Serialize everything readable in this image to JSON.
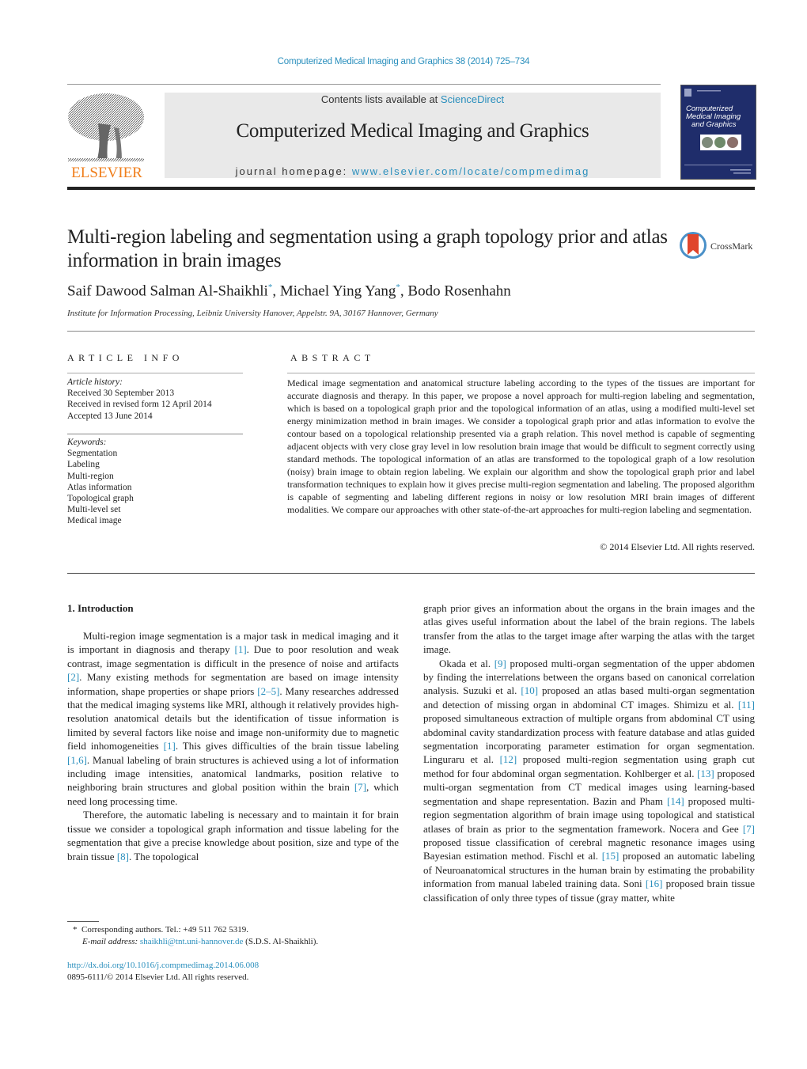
{
  "header": {
    "journal_ref": "Computerized Medical Imaging and Graphics 38 (2014) 725–734",
    "contents_prefix": "Contents lists available at ",
    "contents_link": "ScienceDirect",
    "journal_title": "Computerized Medical Imaging and Graphics",
    "homepage_prefix": "journal homepage: ",
    "homepage_link": "www.elsevier.com/locate/compmedimag",
    "publisher_logo_text": "ELSEVIER",
    "cover_title": "Computerized Medical Imaging and Graphics",
    "colors": {
      "link": "#2a8fbd",
      "elsevier_orange": "#f07e1b",
      "cover_blue": "#1f2d6b"
    }
  },
  "article": {
    "title": "Multi-region labeling and segmentation using a graph topology prior and atlas information in brain images",
    "crossmark_label": "CrossMark",
    "authors": [
      {
        "name": "Saif Dawood Salman Al-Shaikhli",
        "mark": "*"
      },
      {
        "name": "Michael Ying Yang",
        "mark": "*"
      },
      {
        "name": "Bodo Rosenhahn",
        "mark": ""
      }
    ],
    "affiliation": "Institute for Information Processing, Leibniz University Hanover, Appelstr. 9A, 30167 Hannover, Germany"
  },
  "article_info": {
    "heading": "ARTICLE INFO",
    "history_label": "Article history:",
    "history": [
      "Received 30 September 2013",
      "Received in revised form 12 April 2014",
      "Accepted 13 June 2014"
    ],
    "keywords_label": "Keywords:",
    "keywords": [
      "Segmentation",
      "Labeling",
      "Multi-region",
      "Atlas information",
      "Topological graph",
      "Multi-level set",
      "Medical image"
    ]
  },
  "abstract": {
    "heading": "ABSTRACT",
    "text": "Medical image segmentation and anatomical structure labeling according to the types of the tissues are important for accurate diagnosis and therapy. In this paper, we propose a novel approach for multi-region labeling and segmentation, which is based on a topological graph prior and the topological information of an atlas, using a modified multi-level set energy minimization method in brain images. We consider a topological graph prior and atlas information to evolve the contour based on a topological relationship presented via a graph relation. This novel method is capable of segmenting adjacent objects with very close gray level in low resolution brain image that would be difficult to segment correctly using standard methods. The topological information of an atlas are transformed to the topological graph of a low resolution (noisy) brain image to obtain region labeling. We explain our algorithm and show the topological graph prior and label transformation techniques to explain how it gives precise multi-region segmentation and labeling. The proposed algorithm is capable of segmenting and labeling different regions in noisy or low resolution MRI brain images of different modalities. We compare our approaches with other state-of-the-art approaches for multi-region labeling and segmentation.",
    "copyright": "© 2014 Elsevier Ltd. All rights reserved."
  },
  "body": {
    "section_heading": "1.  Introduction",
    "col1": [
      [
        {
          "t": "Multi-region image segmentation is a major task in medical imaging and it is important in diagnosis and therapy "
        },
        {
          "ref": "[1]"
        },
        {
          "t": ". Due to poor resolution and weak contrast, image segmentation is difficult in the presence of noise and artifacts "
        },
        {
          "ref": "[2]"
        },
        {
          "t": ". Many existing methods for segmentation are based on image intensity information, shape properties or shape priors "
        },
        {
          "ref": "[2–5]"
        },
        {
          "t": ". Many researches addressed that the medical imaging systems like MRI, although it relatively provides high-resolution anatomical details but the identification of tissue information is limited by several factors like noise and image non-uniformity due to magnetic field inhomogeneities "
        },
        {
          "ref": "[1]"
        },
        {
          "t": ". This gives difficulties of the brain tissue labeling "
        },
        {
          "ref": "[1,6]"
        },
        {
          "t": ". Manual labeling of brain structures is achieved using a lot of information including image intensities, anatomical landmarks, position relative to neighboring brain structures and global position within the brain "
        },
        {
          "ref": "[7]"
        },
        {
          "t": ", which need long processing time."
        }
      ],
      [
        {
          "t": "Therefore, the automatic labeling is necessary and to maintain it for brain tissue we consider a topological graph information and tissue labeling for the segmentation that give a precise knowledge about position, size and type of the brain tissue "
        },
        {
          "ref": "[8]"
        },
        {
          "t": ". The topological"
        }
      ]
    ],
    "col2": [
      [
        {
          "t": "graph prior gives an information about the organs in the brain images and the atlas gives useful information about the label of the brain regions. The labels transfer from the atlas to the target image after warping the atlas with the target image."
        }
      ],
      [
        {
          "t": "Okada et al. "
        },
        {
          "ref": "[9]"
        },
        {
          "t": " proposed multi-organ segmentation of the upper abdomen by finding the interrelations between the organs based on canonical correlation analysis. Suzuki et al. "
        },
        {
          "ref": "[10]"
        },
        {
          "t": " proposed an atlas based multi-organ segmentation and detection of missing organ in abdominal CT images. Shimizu et al. "
        },
        {
          "ref": "[11]"
        },
        {
          "t": " proposed simultaneous extraction of multiple organs from abdominal CT using abdominal cavity standardization process with feature database and atlas guided segmentation incorporating parameter estimation for organ segmentation. Linguraru et al. "
        },
        {
          "ref": "[12]"
        },
        {
          "t": " proposed multi-region segmentation using graph cut method for four abdominal organ segmentation. Kohlberger et al. "
        },
        {
          "ref": "[13]"
        },
        {
          "t": " proposed multi-organ segmentation from CT medical images using learning-based segmentation and shape representation. Bazin and Pham "
        },
        {
          "ref": "[14]"
        },
        {
          "t": " proposed multi-region segmentation algorithm of brain image using topological and statistical atlases of brain as prior to the segmentation framework. Nocera and Gee "
        },
        {
          "ref": "[7]"
        },
        {
          "t": " proposed tissue classification of cerebral magnetic resonance images using Bayesian estimation method. Fischl et al. "
        },
        {
          "ref": "[15]"
        },
        {
          "t": " proposed an automatic labeling of Neuroanatomical structures in the human brain by estimating the probability information from manual labeled training data. Soni "
        },
        {
          "ref": "[16]"
        },
        {
          "t": " proposed brain tissue classification of only three types of tissue (gray matter, white"
        }
      ]
    ]
  },
  "footnote": {
    "mark": "*",
    "text": "Corresponding authors. Tel.: +49 511 762 5319.",
    "email_label": "E-mail address:",
    "email": "shaikhli@tnt.uni-hannover.de",
    "email_suffix": " (S.D.S. Al-Shaikhli)."
  },
  "doi": {
    "link": "http://dx.doi.org/10.1016/j.compmedimag.2014.06.008",
    "issn_line": "0895-6111/© 2014 Elsevier Ltd. All rights reserved."
  }
}
